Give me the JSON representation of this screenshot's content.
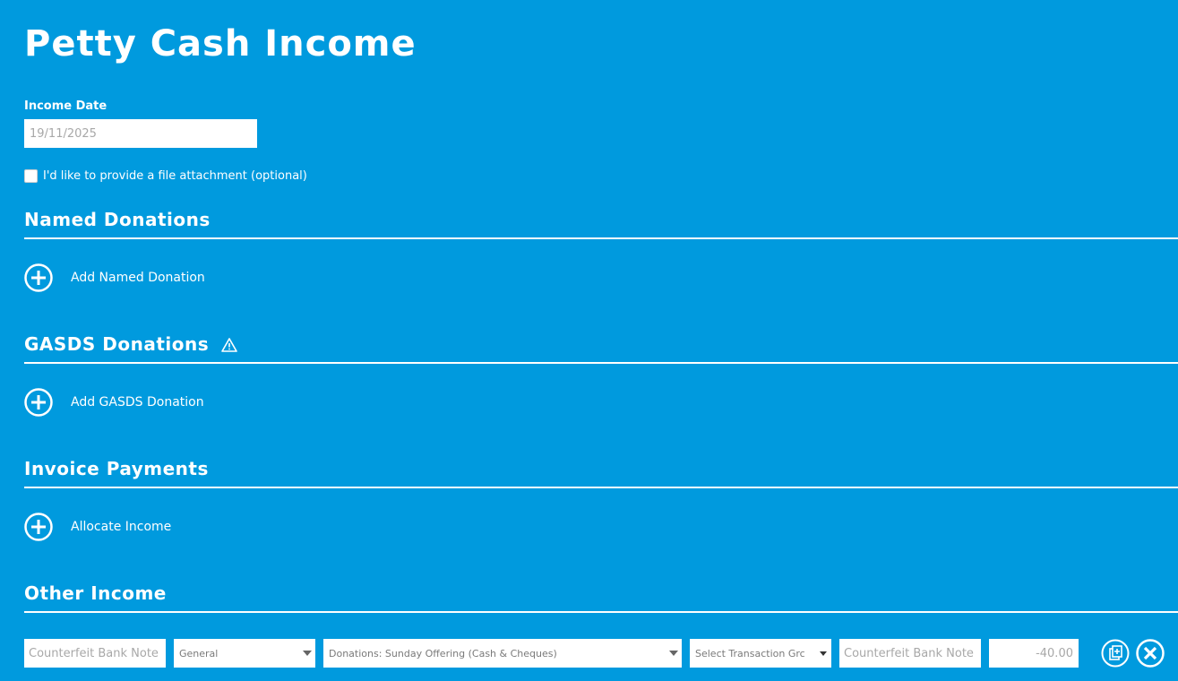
{
  "page": {
    "title": "Petty Cash Income"
  },
  "income_date": {
    "label": "Income Date",
    "value": "19/11/2025"
  },
  "attachment": {
    "label": "I'd like to provide a file attachment (optional)",
    "checked": false
  },
  "sections": {
    "named": {
      "title": "Named Donations",
      "add_label": "Add Named Donation"
    },
    "gasds": {
      "title": "GASDS Donations",
      "add_label": "Add GASDS Donation"
    },
    "invoice": {
      "title": "Invoice Payments",
      "add_label": "Allocate Income"
    },
    "other": {
      "title": "Other Income"
    }
  },
  "other_income_row": {
    "description": "Counterfeit Bank Note",
    "fund": "General",
    "category": "Donations: Sunday Offering (Cash & Cheques)",
    "transaction_group": "Select Transaction Grc",
    "reference": "Counterfeit Bank Note",
    "amount": "-40.00"
  },
  "icons": {
    "add": "plus-circle-icon",
    "warning": "warning-triangle-icon",
    "duplicate": "duplicate-icon",
    "remove": "close-circle-icon"
  },
  "colors": {
    "background": "#009ade",
    "foreground": "#ffffff"
  }
}
